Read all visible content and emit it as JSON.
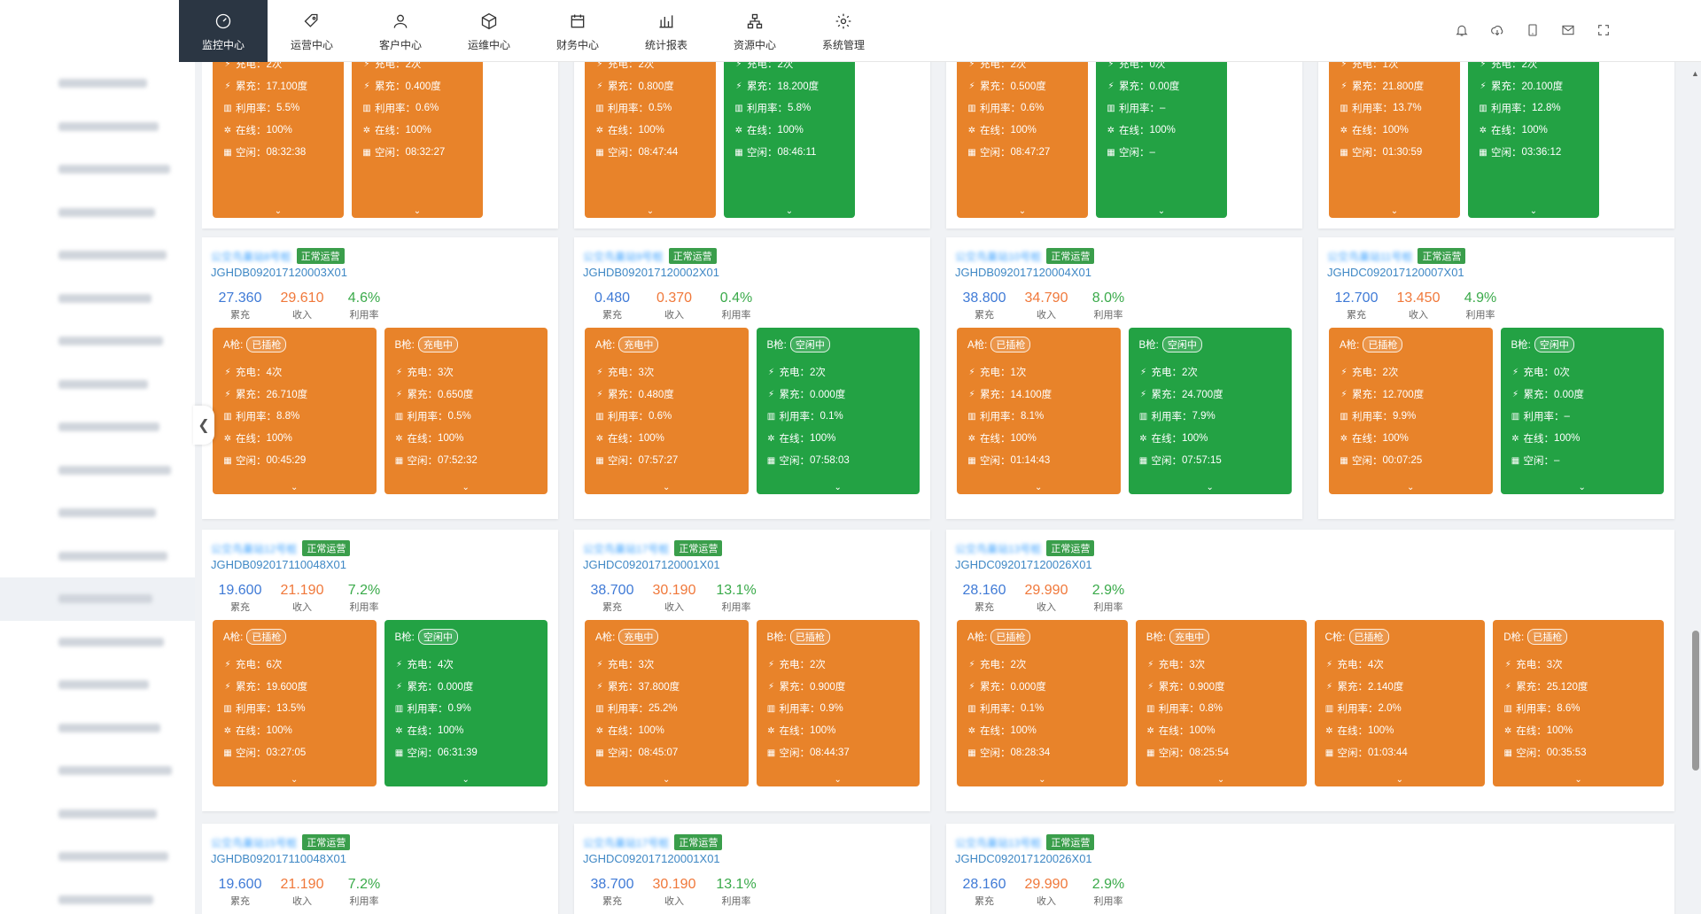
{
  "nav": {
    "items": [
      {
        "label": "监控中心",
        "icon": "dashboard-icon",
        "active": true
      },
      {
        "label": "运营中心",
        "icon": "tag-icon",
        "active": false
      },
      {
        "label": "客户中心",
        "icon": "user-icon",
        "active": false
      },
      {
        "label": "运维中心",
        "icon": "hexagon-icon",
        "active": false
      },
      {
        "label": "财务中心",
        "icon": "calendar-icon",
        "active": false
      },
      {
        "label": "统计报表",
        "icon": "bar-chart-icon",
        "active": false
      },
      {
        "label": "资源中心",
        "icon": "sitemap-icon",
        "active": false
      },
      {
        "label": "系统管理",
        "icon": "gear-icon",
        "active": false
      }
    ]
  },
  "tools": [
    "bell-icon",
    "cloud-download-icon",
    "tablet-icon",
    "mail-icon",
    "fullscreen-icon"
  ],
  "labels": {
    "charge_count": "充电：",
    "total": "累充：",
    "util": "利用率：",
    "online": "在线：",
    "idle": "空闲：",
    "stat_total": "累充",
    "stat_income": "收入",
    "stat_util": "利用率"
  },
  "colors": {
    "orange": "#e8832a",
    "green": "#23a244",
    "nav_active": "#2b3643",
    "link": "#3f88c5"
  },
  "top_strip": [
    {
      "count": "2次",
      "total": "17.100度",
      "util": "5.5%",
      "online": "100%",
      "idle": "08:32:38",
      "color": "orange"
    },
    {
      "count": "2次",
      "total": "0.400度",
      "util": "0.6%",
      "online": "100%",
      "idle": "08:32:27",
      "color": "orange"
    },
    {
      "count": "2次",
      "total": "0.800度",
      "util": "0.5%",
      "online": "100%",
      "idle": "08:47:44",
      "color": "orange"
    },
    {
      "count": "2次",
      "total": "18.200度",
      "util": "5.8%",
      "online": "100%",
      "idle": "08:46:11",
      "color": "green"
    },
    {
      "count": "2次",
      "total": "0.500度",
      "util": "0.6%",
      "online": "100%",
      "idle": "08:47:27",
      "color": "orange"
    },
    {
      "count": "0次",
      "total": "0.00度",
      "util": "–",
      "online": "100%",
      "idle": "–",
      "color": "green"
    },
    {
      "count": "1次",
      "total": "21.800度",
      "util": "13.7%",
      "online": "100%",
      "idle": "01:30:59",
      "color": "orange"
    },
    {
      "count": "2次",
      "total": "20.100度",
      "util": "12.8%",
      "online": "100%",
      "idle": "03:36:12",
      "color": "green"
    }
  ],
  "stations": [
    {
      "name": "公交鸟巢站8号桩",
      "status": "正常运营",
      "code": "JGHDB092017120003X01",
      "total": "27.360",
      "income": "29.610",
      "util": "4.6%",
      "guns": [
        {
          "label": "A枪:",
          "state": "已插枪",
          "color": "orange",
          "count": "4次",
          "total": "26.710度",
          "util": "8.8%",
          "online": "100%",
          "idle": "00:45:29"
        },
        {
          "label": "B枪:",
          "state": "充电中",
          "color": "orange",
          "count": "3次",
          "total": "0.650度",
          "util": "0.5%",
          "online": "100%",
          "idle": "07:52:32"
        }
      ]
    },
    {
      "name": "公交鸟巢站9号桩",
      "status": "正常运营",
      "code": "JGHDB092017120002X01",
      "total": "0.480",
      "income": "0.370",
      "util": "0.4%",
      "guns": [
        {
          "label": "A枪:",
          "state": "充电中",
          "color": "orange",
          "count": "3次",
          "total": "0.480度",
          "util": "0.6%",
          "online": "100%",
          "idle": "07:57:27"
        },
        {
          "label": "B枪:",
          "state": "空闲中",
          "color": "green",
          "count": "2次",
          "total": "0.000度",
          "util": "0.1%",
          "online": "100%",
          "idle": "07:58:03"
        }
      ]
    },
    {
      "name": "公交鸟巢站10号桩",
      "status": "正常运营",
      "code": "JGHDB092017120004X01",
      "total": "38.800",
      "income": "34.790",
      "util": "8.0%",
      "guns": [
        {
          "label": "A枪:",
          "state": "已插枪",
          "color": "orange",
          "count": "1次",
          "total": "14.100度",
          "util": "8.1%",
          "online": "100%",
          "idle": "01:14:43"
        },
        {
          "label": "B枪:",
          "state": "空闲中",
          "color": "green",
          "count": "2次",
          "total": "24.700度",
          "util": "7.9%",
          "online": "100%",
          "idle": "07:57:15"
        }
      ]
    },
    {
      "name": "公交鸟巢站11号桩",
      "status": "正常运营",
      "code": "JGHDC092017120007X01",
      "total": "12.700",
      "income": "13.450",
      "util": "4.9%",
      "guns": [
        {
          "label": "A枪:",
          "state": "已插枪",
          "color": "orange",
          "count": "2次",
          "total": "12.700度",
          "util": "9.9%",
          "online": "100%",
          "idle": "00:07:25"
        },
        {
          "label": "B枪:",
          "state": "空闲中",
          "color": "green",
          "count": "0次",
          "total": "0.00度",
          "util": "–",
          "online": "100%",
          "idle": "–"
        }
      ]
    },
    {
      "name": "公交鸟巢站12号桩",
      "status": "正常运营",
      "code": "JGHDB092017110048X01",
      "total": "19.600",
      "income": "21.190",
      "util": "7.2%",
      "guns": [
        {
          "label": "A枪:",
          "state": "已插枪",
          "color": "orange",
          "count": "6次",
          "total": "19.600度",
          "util": "13.5%",
          "online": "100%",
          "idle": "03:27:05"
        },
        {
          "label": "B枪:",
          "state": "空闲中",
          "color": "green",
          "count": "4次",
          "total": "0.000度",
          "util": "0.9%",
          "online": "100%",
          "idle": "06:31:39"
        }
      ]
    },
    {
      "name": "公交鸟巢站17号桩",
      "status": "正常运营",
      "code": "JGHDC092017120001X01",
      "total": "38.700",
      "income": "30.190",
      "util": "13.1%",
      "guns": [
        {
          "label": "A枪:",
          "state": "充电中",
          "color": "orange",
          "count": "3次",
          "total": "37.800度",
          "util": "25.2%",
          "online": "100%",
          "idle": "08:45:07"
        },
        {
          "label": "B枪:",
          "state": "已插枪",
          "color": "orange",
          "count": "2次",
          "total": "0.900度",
          "util": "0.9%",
          "online": "100%",
          "idle": "08:44:37"
        }
      ]
    },
    {
      "name": "公交鸟巢站13号桩",
      "status": "正常运营",
      "code": "JGHDC092017120026X01",
      "total": "28.160",
      "income": "29.990",
      "util": "2.9%",
      "guns": [
        {
          "label": "A枪:",
          "state": "已插枪",
          "color": "orange",
          "count": "2次",
          "total": "0.000度",
          "util": "0.1%",
          "online": "100%",
          "idle": "08:28:34"
        },
        {
          "label": "B枪:",
          "state": "充电中",
          "color": "orange",
          "count": "3次",
          "total": "0.900度",
          "util": "0.8%",
          "online": "100%",
          "idle": "08:25:54"
        },
        {
          "label": "C枪:",
          "state": "已插枪",
          "color": "orange",
          "count": "4次",
          "total": "2.140度",
          "util": "2.0%",
          "online": "100%",
          "idle": "01:03:44"
        },
        {
          "label": "D枪:",
          "state": "已插枪",
          "color": "orange",
          "count": "3次",
          "total": "25.120度",
          "util": "8.6%",
          "online": "100%",
          "idle": "00:35:53"
        }
      ]
    },
    {
      "name": "公交鸟巢站15号桩",
      "status": "正常运营",
      "code": "JGHDB092017110048X01",
      "total": "19.600",
      "income": "21.190",
      "util": "7.2%",
      "guns": []
    },
    {
      "name": "公交鸟巢站17号桩",
      "status": "正常运营",
      "code": "JGHDC092017120001X01",
      "total": "38.700",
      "income": "30.190",
      "util": "13.1%",
      "guns": []
    },
    {
      "name": "公交鸟巢站13号桩",
      "status": "正常运营",
      "code": "JGHDC092017120026X01",
      "total": "28.160",
      "income": "29.990",
      "util": "2.9%",
      "guns": []
    }
  ],
  "sidebar_rows": 20
}
